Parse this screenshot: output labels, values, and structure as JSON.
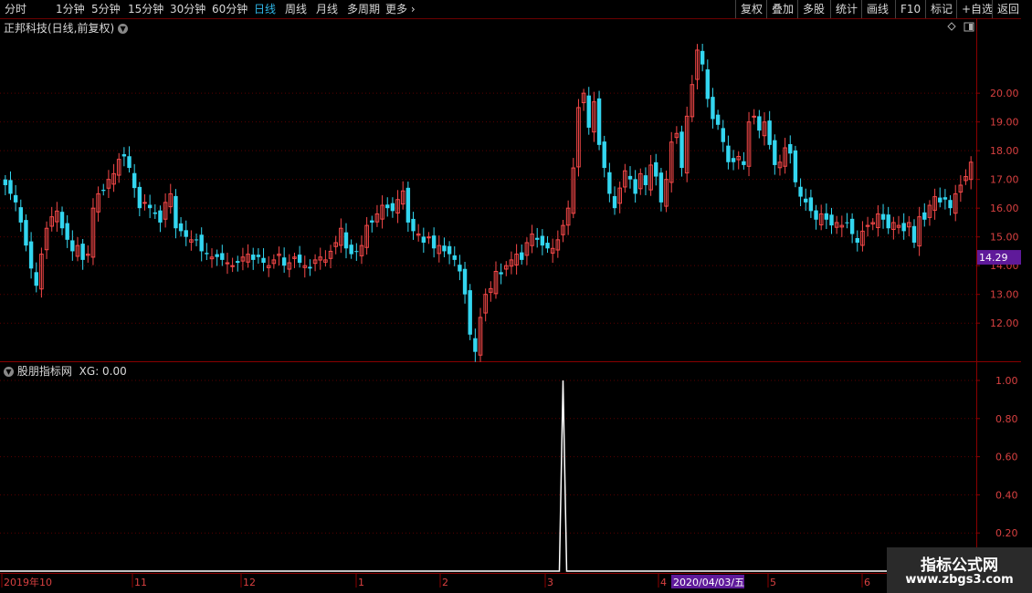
{
  "toolbar": {
    "periods": [
      "分时",
      "1分钟",
      "5分钟",
      "15分钟",
      "30分钟",
      "60分钟",
      "日线",
      "周线",
      "月线",
      "多周期",
      "更多"
    ],
    "active_period": "日线",
    "right_buttons": [
      "复权",
      "叠加",
      "多股",
      "统计",
      "画线",
      "F10",
      "标记",
      "+自选",
      "返回"
    ]
  },
  "price_panel": {
    "title": "正邦科技(日线,前复权)",
    "current_price": "14.29"
  },
  "indicator_panel": {
    "title": "股朋指标网",
    "value_label": "XG: 0.00"
  },
  "cursor_date": "2020/04/03/五",
  "watermark": {
    "title": "指标公式网",
    "url": "www.zbgs3.com"
  },
  "colors": {
    "up": "#f54848",
    "down": "#33d6f0",
    "grid": "#5a0000",
    "axis_text": "#d84040",
    "indicator_line": "#ffffff",
    "price_tag_bg": "#5f1a9a"
  },
  "chart_data": [
    {
      "type": "candlestick",
      "title": "正邦科技(日线,前复权)",
      "y_ticks": [
        "12.00",
        "13.00",
        "14.00",
        "15.00",
        "16.00",
        "17.00",
        "18.00",
        "19.00",
        "20.00"
      ],
      "ylim": [
        10.8,
        22.1
      ],
      "x_ticks": [
        "2019年10",
        "11",
        "12",
        "1",
        "2",
        "3",
        "4",
        "5",
        "6"
      ],
      "last_price": 14.29,
      "closes": [
        16.8,
        16.5,
        16.2,
        15.5,
        14.7,
        13.9,
        13.3,
        14.4,
        15.3,
        15.7,
        15.9,
        15.3,
        14.9,
        14.5,
        14.7,
        14.2,
        14.4,
        16.0,
        16.5,
        16.6,
        17.0,
        17.2,
        17.7,
        17.8,
        17.4,
        16.7,
        16.0,
        16.2,
        16.0,
        15.8,
        15.5,
        16.2,
        16.5,
        15.3,
        15.2,
        15.0,
        14.9,
        14.9,
        14.5,
        14.4,
        14.3,
        14.3,
        14.2,
        14.1,
        14.0,
        14.1,
        14.3,
        14.4,
        14.2,
        14.3,
        14.1,
        14.0,
        14.2,
        14.4,
        14.0,
        14.1,
        14.3,
        14.1,
        14.0,
        13.9,
        14.2,
        14.3,
        14.2,
        14.5,
        14.8,
        15.3,
        14.6,
        14.4,
        14.5,
        14.7,
        15.4,
        15.5,
        15.8,
        16.1,
        16.0,
        15.9,
        16.3,
        16.6,
        15.5,
        15.2,
        15.1,
        14.8,
        15.0,
        14.6,
        14.7,
        14.5,
        14.4,
        14.2,
        13.8,
        13.0,
        11.6,
        11.0,
        12.2,
        13.0,
        13.2,
        13.8,
        13.7,
        14.0,
        14.2,
        14.4,
        14.2,
        14.8,
        15.1,
        14.9,
        14.7,
        14.6,
        14.6,
        14.9,
        15.4,
        16.0,
        17.4,
        19.5,
        20.0,
        18.8,
        19.7,
        18.2,
        17.4,
        16.5,
        16.0,
        16.7,
        17.3,
        17.0,
        16.5,
        17.2,
        16.8,
        17.5,
        17.1,
        16.2,
        17.0,
        18.3,
        18.6,
        17.4,
        19.2,
        20.3,
        21.5,
        21.0,
        19.8,
        19.1,
        18.9,
        18.3,
        17.6,
        17.6,
        17.8,
        17.5,
        19.0,
        19.2,
        18.7,
        19.0,
        18.2,
        17.5,
        17.6,
        18.1,
        17.9,
        16.9,
        16.4,
        16.2,
        15.9,
        15.6,
        15.8,
        15.6,
        15.4,
        15.5,
        15.4,
        15.5,
        15.1,
        14.8,
        15.2,
        15.4,
        15.5,
        15.8,
        15.6,
        15.3,
        15.5,
        15.4,
        15.2,
        15.5,
        14.8,
        15.7,
        15.6,
        16.1,
        16.4,
        16.2,
        16.3,
        16.0,
        16.5,
        16.8,
        17.1,
        17.6
      ]
    },
    {
      "type": "line",
      "title": "股朋指标网",
      "series": [
        {
          "name": "XG",
          "spike_at_index": 108,
          "peak": 1.0,
          "base": 0.0
        }
      ],
      "y_ticks": [
        "0.20",
        "0.40",
        "0.60",
        "0.80",
        "1.00"
      ],
      "ylim": [
        0,
        1
      ]
    }
  ]
}
